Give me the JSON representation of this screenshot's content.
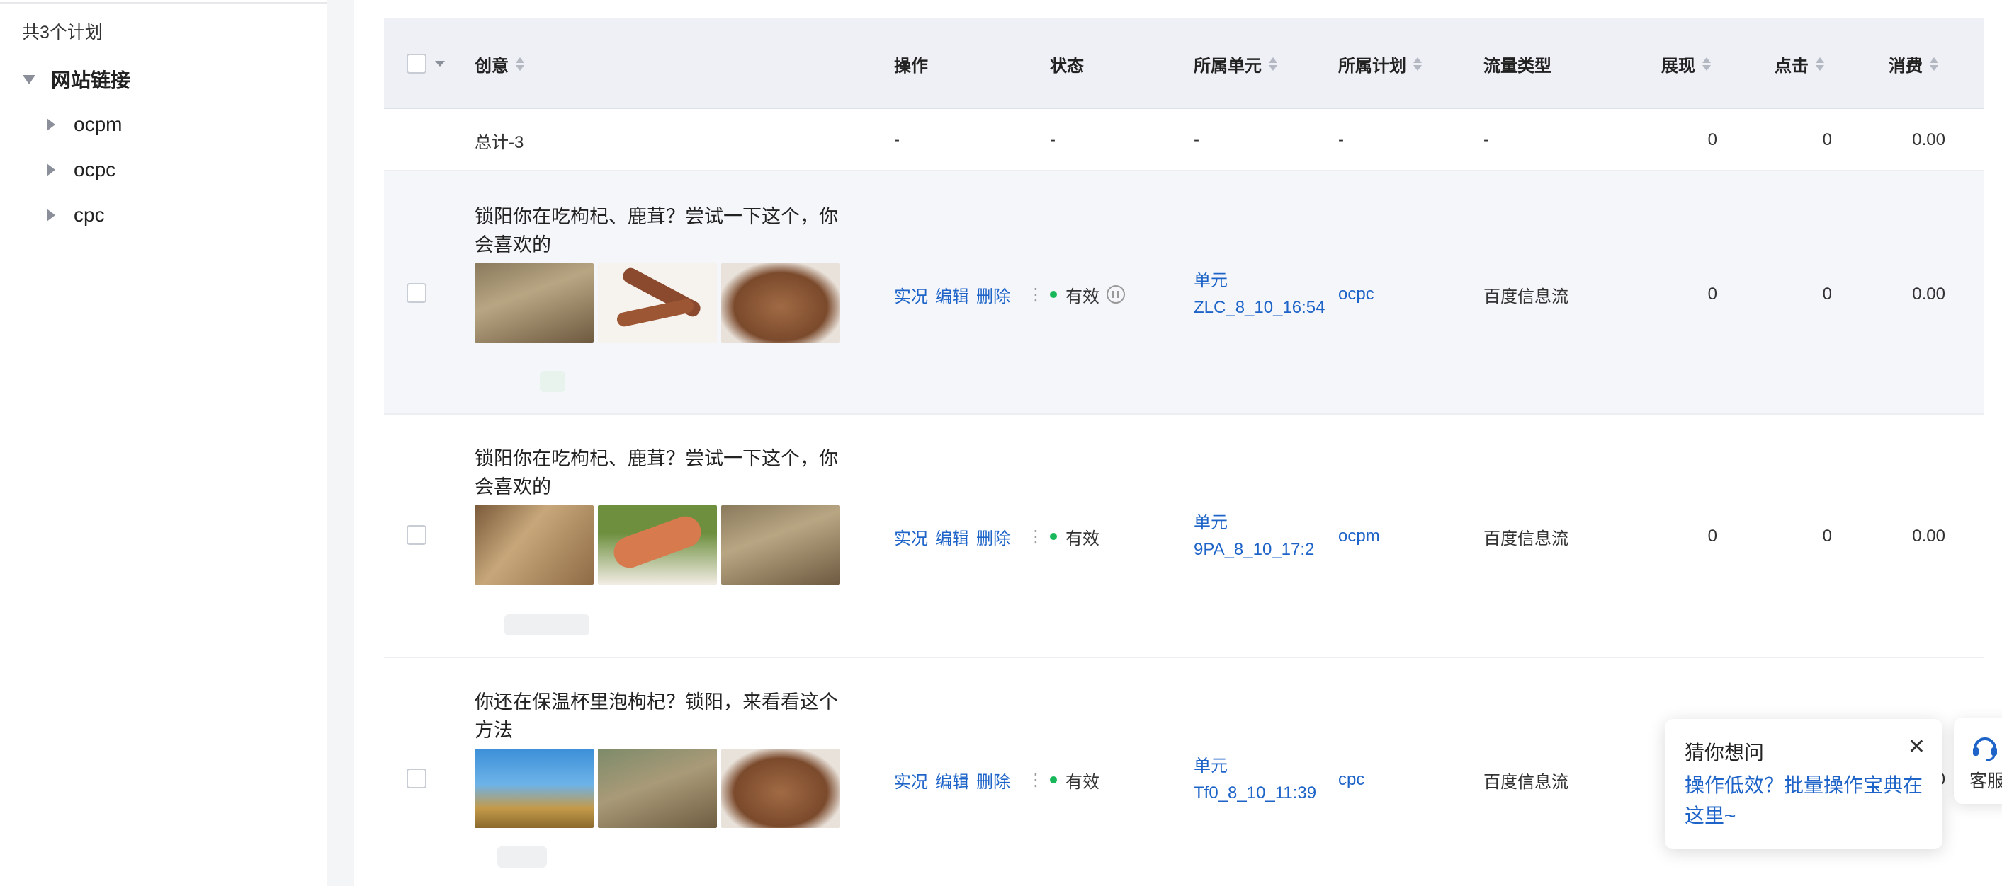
{
  "sidebar": {
    "plan_count": "共3个计划",
    "root": "网站链接",
    "children": [
      "ocpm",
      "ocpc",
      "cpc"
    ]
  },
  "table": {
    "headers": {
      "creative": "创意",
      "action": "操作",
      "status": "状态",
      "unit": "所属单元",
      "plan": "所属计划",
      "traffic": "流量类型",
      "impressions": "展现",
      "clicks": "点击",
      "cost": "消费"
    },
    "total": {
      "label": "总计-3",
      "action": "-",
      "status": "-",
      "unit": "-",
      "plan": "-",
      "traffic": "-",
      "impressions": "0",
      "clicks": "0",
      "cost": "0.00"
    },
    "rows": [
      {
        "title": "锁阳你在吃枸杞、鹿茸？尝试一下这个，你会喜欢的",
        "ops": [
          "实况",
          "编辑",
          "删除"
        ],
        "more": "⋮",
        "status": "有效",
        "paused_icon": "pause-circle-icon",
        "unit": "单元ZLC_8_10_16:54",
        "plan": "ocpc",
        "traffic": "百度信息流",
        "impressions": "0",
        "clicks": "0",
        "cost": "0.00"
      },
      {
        "title": "锁阳你在吃枸杞、鹿茸？尝试一下这个，你会喜欢的",
        "ops": [
          "实况",
          "编辑",
          "删除"
        ],
        "more": "⋮",
        "status": "有效",
        "unit": "单元9PA_8_10_17:2",
        "plan": "ocpm",
        "traffic": "百度信息流",
        "impressions": "0",
        "clicks": "0",
        "cost": "0.00"
      },
      {
        "title": "你还在保温杯里泡枸杞？锁阳，来看看这个方法",
        "ops": [
          "实况",
          "编辑",
          "删除"
        ],
        "more": "⋮",
        "status": "有效",
        "unit": "单元Tf0_8_10_11:39",
        "plan": "cpc",
        "traffic": "百度信息流",
        "impressions": "",
        "clicks": "",
        "cost": "0"
      }
    ]
  },
  "popup": {
    "title": "猜你想问",
    "close": "✕",
    "link": "操作低效？批量操作宝典在这里~"
  },
  "service": {
    "label": "客服",
    "icon": "headset-icon"
  },
  "colors": {
    "link": "#1e64c8",
    "status_green": "#18b85a",
    "header_bg": "#eef0f5",
    "row_highlight": "#f4f6fa"
  }
}
